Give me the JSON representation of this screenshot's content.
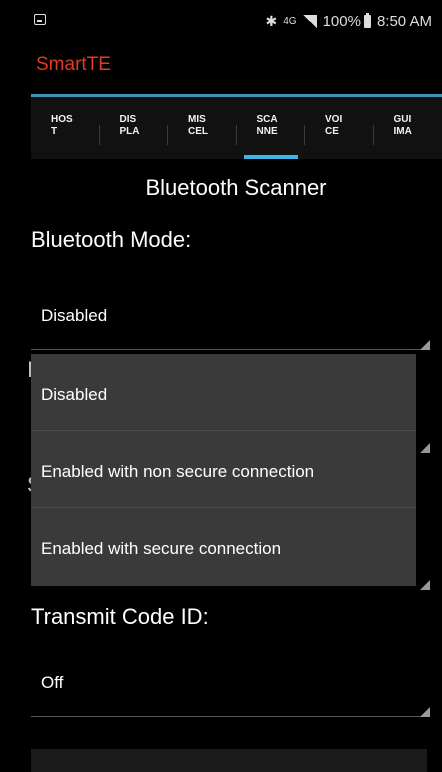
{
  "status_bar": {
    "icons": [
      "notification-icon",
      "bluetooth-icon",
      "lte-icon",
      "signal-icon",
      "battery-icon"
    ],
    "bluetooth_glyph": "✱",
    "network_label": "4G",
    "battery": "100%",
    "time": "8:50 AM"
  },
  "app": {
    "title": "SmartTE",
    "title_color": "#e23b1e",
    "accent": "#3db5e6"
  },
  "tabs": [
    {
      "line1": "HOS",
      "line2": "T"
    },
    {
      "line1": "DIS",
      "line2": "PLA"
    },
    {
      "line1": "MIS",
      "line2": "CEL"
    },
    {
      "line1": "SCA",
      "line2": "NNE"
    },
    {
      "line1": "VOI",
      "line2": "CE"
    },
    {
      "line1": "GUI",
      "line2": "IMA"
    }
  ],
  "active_tab": 3,
  "page": {
    "section_title": "Bluetooth Scanner"
  },
  "fields": {
    "bluetooth_mode": {
      "label": "Bluetooth Mode:",
      "value": "Disabled"
    },
    "hidden_label_1_initial": "I",
    "hidden_label_2_initial": "S",
    "transmit_code_id": {
      "label": "Transmit Code ID:",
      "value": "Off"
    }
  },
  "dropdown": {
    "options": [
      "Disabled",
      "Enabled with non secure connection",
      "Enabled with secure connection"
    ]
  }
}
